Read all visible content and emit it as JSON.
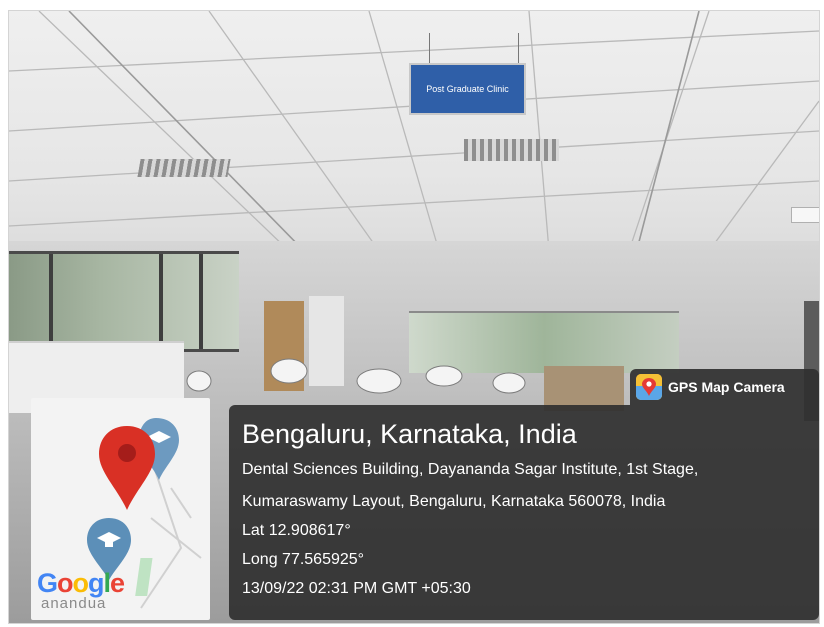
{
  "scene": {
    "sign_text": "Post Graduate Clinic"
  },
  "badge": {
    "label": "GPS Map Camera",
    "icon": "gps-map-camera-app-icon"
  },
  "location": {
    "title": "Bengaluru, Karnataka, India",
    "address_line_1": "Dental Sciences Building, Dayananda Sagar Institute, 1st Stage,",
    "address_line_2": "Kumaraswamy Layout, Bengaluru, Karnataka 560078, India",
    "lat": "Lat 12.908617°",
    "long": "Long 77.565925°",
    "timestamp": "13/09/22 02:31 PM GMT +05:30"
  },
  "map": {
    "logo": "Google",
    "bottom_text": "anandua",
    "icons": [
      "red-map-pin-icon",
      "graduation-cap-pin-icon",
      "graduation-cap-pin-icon"
    ]
  },
  "colors": {
    "overlay": "#303030",
    "pin_red": "#d93025",
    "pin_blue": "#5c8fb8",
    "sign_blue": "#2f5fa8"
  }
}
